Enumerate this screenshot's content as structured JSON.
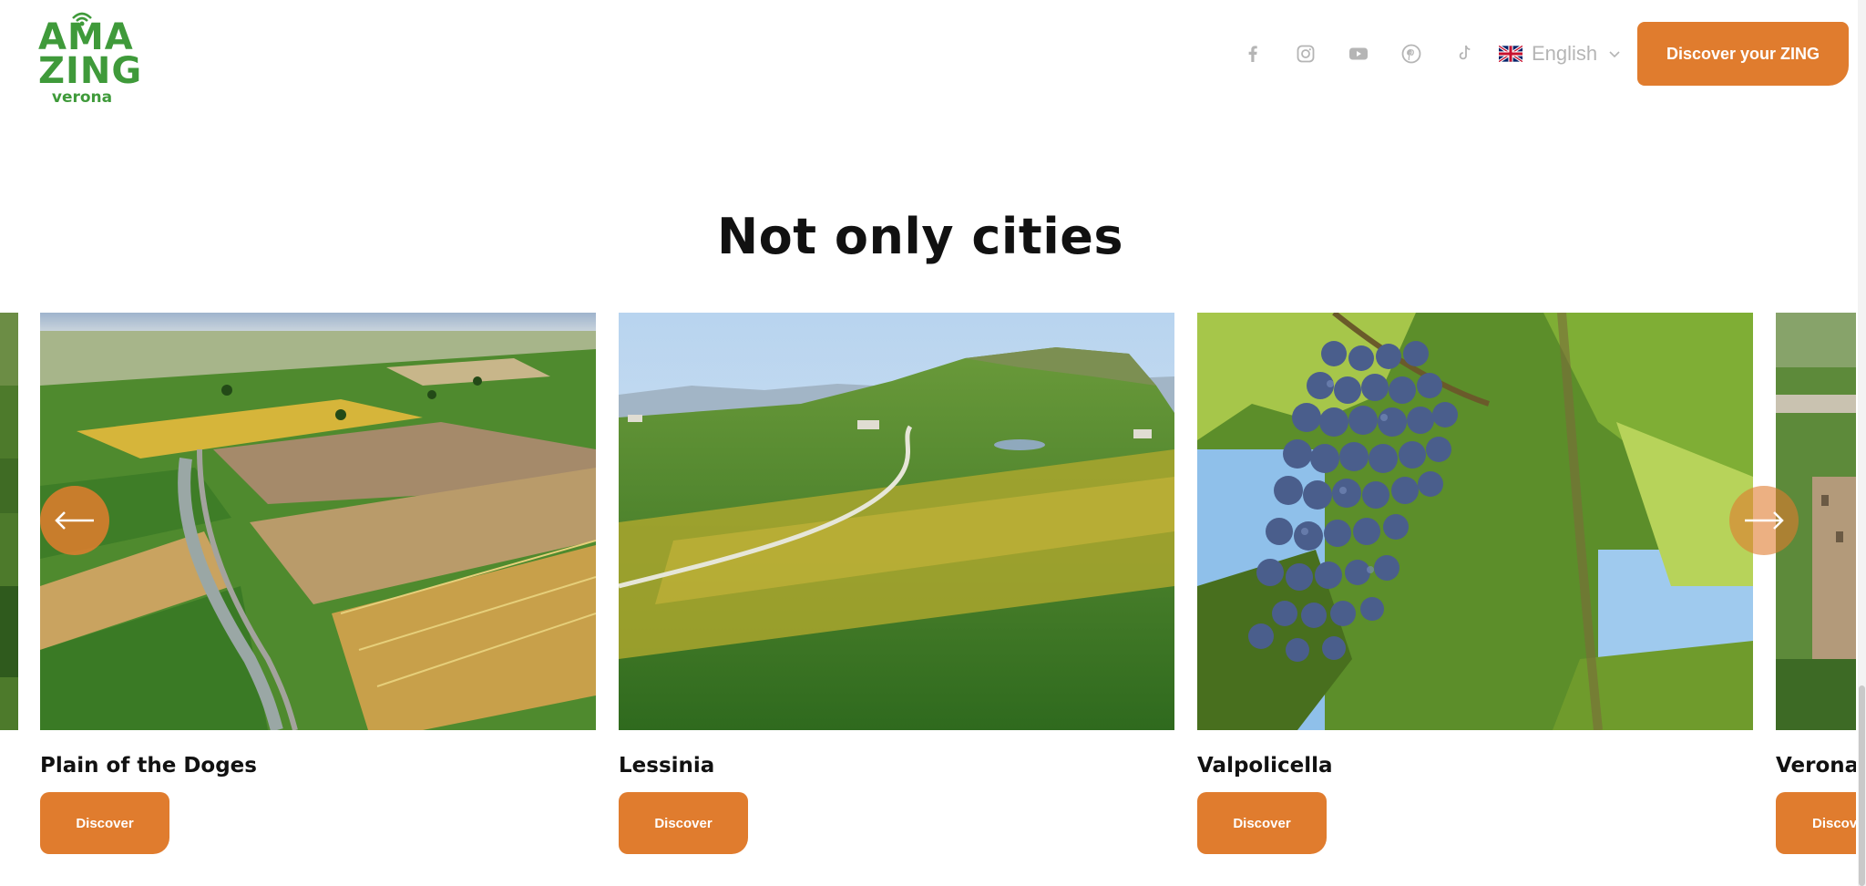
{
  "header": {
    "logo": {
      "line1": "AMA",
      "line2": "ZING",
      "line3": "verona"
    },
    "social": [
      {
        "name": "facebook-icon"
      },
      {
        "name": "instagram-icon"
      },
      {
        "name": "youtube-icon"
      },
      {
        "name": "pinterest-icon"
      },
      {
        "name": "tiktok-icon"
      }
    ],
    "language": {
      "selected": "English",
      "flag": "uk-flag-icon"
    },
    "cta_label": "Discover your ZING"
  },
  "section": {
    "title": "Not only cities",
    "cards": [
      {
        "name": "Plain of the Doges",
        "button": "Discover"
      },
      {
        "name": "Lessinia",
        "button": "Discover"
      },
      {
        "name": "Valpolicella",
        "button": "Discover"
      }
    ],
    "partial_card": {
      "name": "Verona E",
      "button": "Discover"
    }
  },
  "colors": {
    "accent": "#e07c2e",
    "logo": "#3f9a3a",
    "icon_gray": "#b5b5b5"
  },
  "icons": {
    "prev": "arrow-left-icon",
    "next": "arrow-right-icon"
  }
}
